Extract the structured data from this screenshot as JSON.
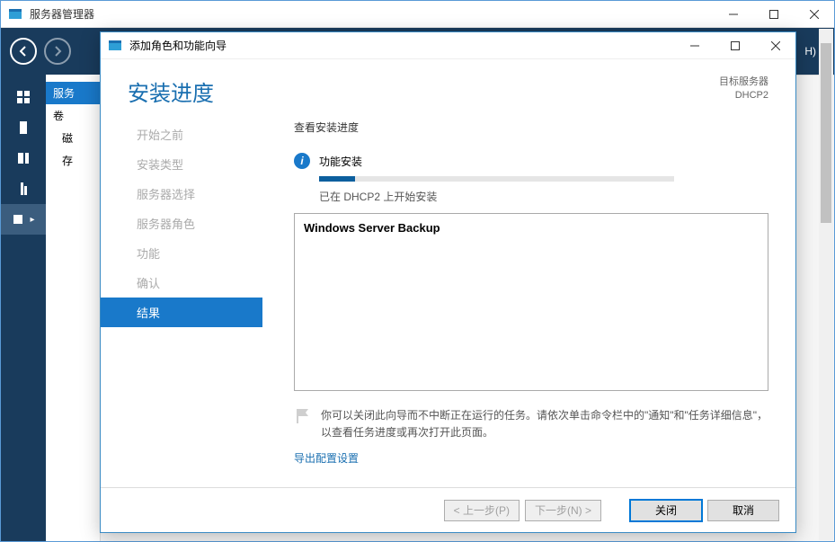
{
  "parent_window": {
    "title": "服务器管理器",
    "toolbar_right": "H)"
  },
  "side_tree": {
    "items": [
      "服务",
      "卷",
      "磁",
      "存"
    ]
  },
  "modal": {
    "title": "添加角色和功能向导",
    "heading": "安装进度",
    "target_label": "目标服务器",
    "target_value": "DHCP2",
    "steps": [
      "开始之前",
      "安装类型",
      "服务器选择",
      "服务器角色",
      "功能",
      "确认",
      "结果"
    ],
    "active_step_index": 6,
    "body": {
      "section_title": "查看安装进度",
      "status_label": "功能安装",
      "status_text": "已在 DHCP2 上开始安装",
      "feature_name": "Windows Server Backup",
      "hint_text": "你可以关闭此向导而不中断正在运行的任务。请依次单击命令栏中的\"通知\"和\"任务详细信息\"，以查看任务进度或再次打开此页面。",
      "export_link": "导出配置设置"
    },
    "buttons": {
      "prev": "< 上一步(P)",
      "next": "下一步(N) >",
      "close": "关闭",
      "cancel": "取消"
    }
  }
}
